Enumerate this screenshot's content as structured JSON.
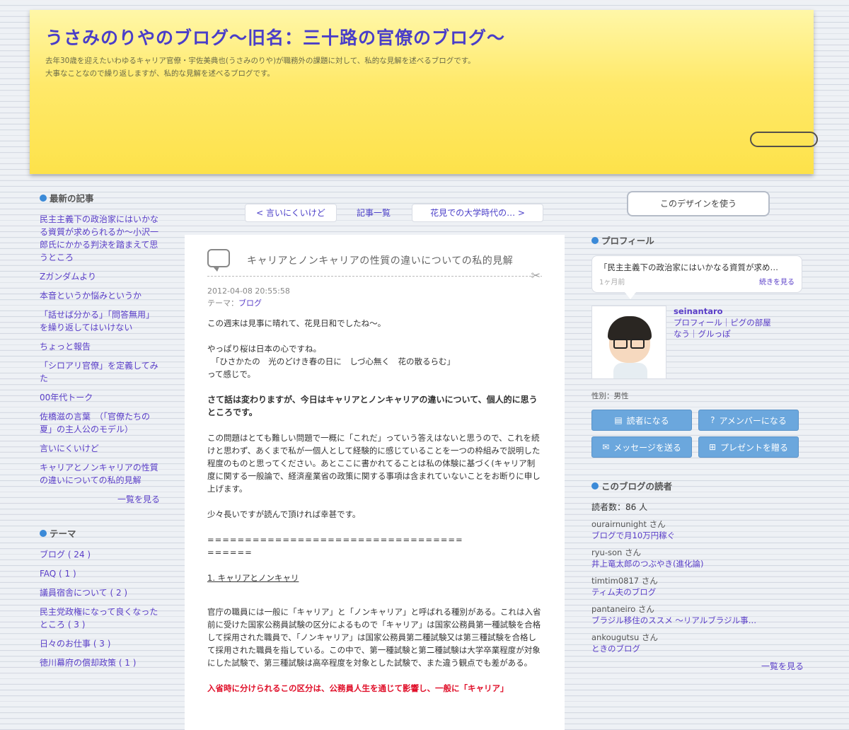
{
  "header": {
    "title": "うさみのりやのブログ～旧名：三十路の官僚のブログ～",
    "desc1": "去年30歳を迎えたいわゆるキャリア官僚・宇佐美典也(うさみのりや)が職務外の課題に対して、私的な見解を述べるブログです。",
    "desc2": "大事なことなので繰り返しますが、私的な見解を述べるブログです。"
  },
  "latest": {
    "title": "最新の記事",
    "items": [
      "民主主義下の政治家にはいかなる資質が求められるか～小沢一郎氏にかかる判決を踏まえて思うところ",
      "Zガンダムより",
      "本音というか悩みというか",
      "「話せば分かる」「問答無用」を繰り返してはいけない",
      "ちょっと報告",
      "「シロアリ官僚」を定義してみた",
      "00年代トーク",
      "佐橋滋の言葉　（「官僚たちの夏」の主人公のモデル）",
      "言いにくいけど",
      "キャリアとノンキャリアの性質の違いについての私的見解"
    ],
    "more": "一覧を見る"
  },
  "theme": {
    "title": "テーマ",
    "items": [
      "ブログ ( 24 )",
      "FAQ ( 1 )",
      "議員宿舎について ( 2 )",
      "民主党政権になって良くなったところ ( 3 )",
      "日々のお仕事 ( 3 )",
      "徳川幕府の償却政策 ( 1 )"
    ]
  },
  "nav": {
    "prev": "< 言いにくいけど",
    "list": "記事一覧",
    "next": "花見での大学時代の… >"
  },
  "article": {
    "title": "キャリアとノンキャリアの性質の違いについての私的見解",
    "date": "2012-04-08 20:55:58",
    "theme_label": "テーマ：",
    "theme_value": "ブログ",
    "p1": "この週末は見事に晴れて、花見日和でしたね～。",
    "p2a": "やっぱり桜は日本の心ですね。",
    "p2b": "　「ひさかたの　光のどけき春の日に　しづ心無く　花の散るらむ」",
    "p2c": "って感じで。",
    "p3": "さて話は変わりますが、今日はキャリアとノンキャリアの違いについて、個人的に思うところです。",
    "p4": "この問題はとても難しい問題で一概に「これだ」っていう答えはないと思うので、これを続けと思わず、あくまで私が一個人として経験的に感じていることを一つの枠組みで説明した程度のものと思ってください。あとここに書かれてることは私の体験に基づく(キャリア制度に関する一般論で、経済産業省の政策に関する事項は含まれていないことをお断りに申し上げます。",
    "p5": "少々長いですが読んで頂ければ幸甚です。",
    "sep": "==================================",
    "sep2": "======",
    "h1": "1. キャリアとノンキャリ",
    "p6": "官庁の職員には一般に「キャリア」と「ノンキャリア」と呼ばれる種別がある。これは入省前に受けた国家公務員試験の区分によるもので「キャリア」は国家公務員第一種試験を合格して採用された職員で、「ノンキャリア」は国家公務員第二種試験又は第三種試験を合格して採用された職員を指している。この中で、第一種試験と第二種試験は大学卒業程度が対象にした試験で、第三種試験は高卒程度を対象とした試験で、また違う観点でも差がある。",
    "p7": "入省時に分けられるこの区分は、公務員人生を通じて影響し、一般に「キャリア」"
  },
  "right": {
    "design_btn": "このデザインを使う",
    "profile_title": "プロフィール",
    "bubble_text": "「民主主義下の政治家にはいかなる資質が求め…",
    "bubble_time": "1ヶ月前",
    "bubble_more": "続きを見る",
    "name": "seinantaro",
    "links1": "プロフィール｜ピグの部屋",
    "links2": "なう｜グルっぽ",
    "gender": "性別：男性",
    "btn_reader": "読者になる",
    "btn_member": "アメンバーになる",
    "btn_message": "メッセージを送る",
    "btn_present": "プレゼントを贈る",
    "readers_title": "このブログの読者",
    "reader_count": "読者数：86 人",
    "readers": [
      {
        "name": "ourairnunight さん",
        "blog": "ブログで月10万円稼ぐ"
      },
      {
        "name": "ryu-son さん",
        "blog": "井上竜太郎のつぶやき(進化論)"
      },
      {
        "name": "timtim0817 さん",
        "blog": "ティム夫のブログ"
      },
      {
        "name": "pantaneiro さん",
        "blog": "ブラジル移住のススメ ～リアルブラジル事…"
      },
      {
        "name": "ankougutsu さん",
        "blog": "ときのブログ"
      }
    ],
    "readers_more": "一覧を見る"
  },
  "colors": {
    "header_yellow": "#fde24a",
    "link_purple": "#5a3ec8",
    "accent_blue": "#3b8ad8",
    "button_blue": "#6ba7dd",
    "alert_red": "#e0102a"
  }
}
